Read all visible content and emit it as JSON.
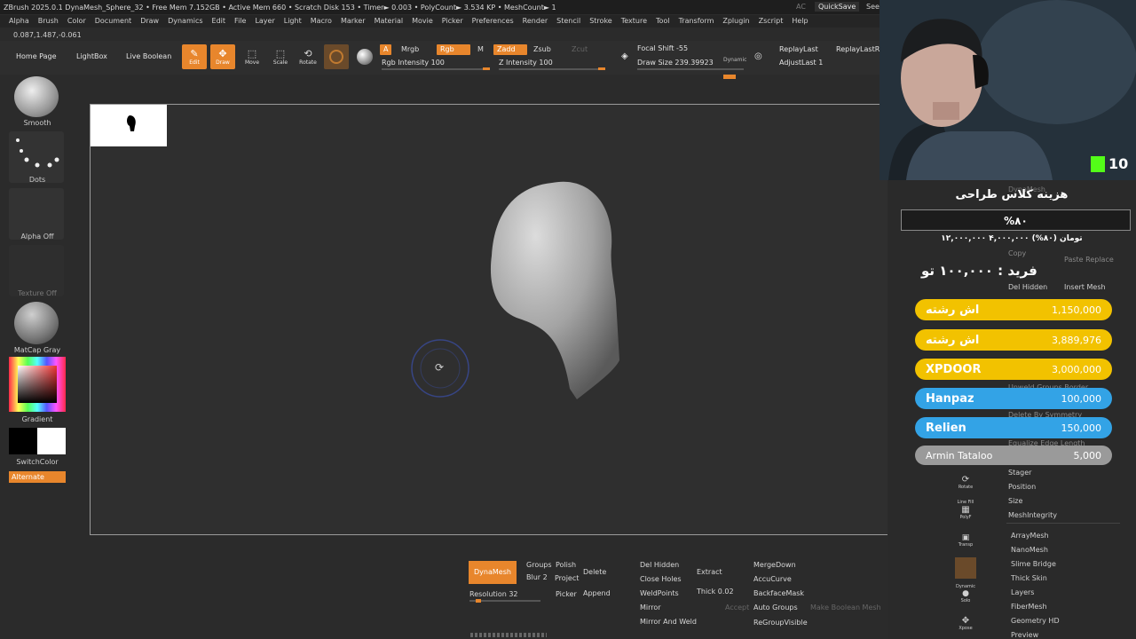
{
  "titlebar": {
    "title": "ZBrush 2025.0.1   DynaMesh_Sphere_32  • Free Mem 7.152GB • Active Mem 660 • Scratch Disk 153 • Timer► 0.003 • PolyCount► 3.534 KP • MeshCount► 1",
    "ac": "AC",
    "quicksave": "QuickSave",
    "see": "See"
  },
  "menu": [
    "Alpha",
    "Brush",
    "Color",
    "Document",
    "Draw",
    "Dynamics",
    "Edit",
    "File",
    "Layer",
    "Light",
    "Macro",
    "Marker",
    "Material",
    "Movie",
    "Picker",
    "Preferences",
    "Render",
    "Stencil",
    "Stroke",
    "Texture",
    "Tool",
    "Transform",
    "Zplugin",
    "Zscript",
    "Help"
  ],
  "coords": "0.087,1.487,-0.061",
  "toolbar": {
    "home": "Home Page",
    "lightbox": "LightBox",
    "live_boolean": "Live Boolean",
    "edit": "Edit",
    "draw": "Draw",
    "move": "Move",
    "scale": "Scale",
    "rotate": "Rotate",
    "a_label": "A",
    "mrgb": "Mrgb",
    "rgb": "Rgb",
    "m": "M",
    "zadd": "Zadd",
    "zsub": "Zsub",
    "zcut": "Zcut",
    "rgb_intensity": "Rgb Intensity 100",
    "z_intensity": "Z Intensity 100",
    "focal_shift": "Focal Shift -55",
    "draw_size": "Draw Size 239.39923",
    "dynamic": "Dynamic",
    "replay_last": "ReplayLast",
    "replay_last_rel": "ReplayLastRel",
    "adjust_last": "AdjustLast 1"
  },
  "left": {
    "smooth": "Smooth",
    "dots": "Dots",
    "alpha_off": "Alpha Off",
    "texture_off": "Texture Off",
    "matcap": "MatCap Gray",
    "gradient": "Gradient",
    "switch_color": "SwitchColor",
    "alternate": "Alternate"
  },
  "bottom": {
    "dynamesh": "DynaMesh",
    "groups": "Groups",
    "polish": "Polish",
    "blur": "Blur 2",
    "project": "Project",
    "delete": "Delete",
    "resolution": "Resolution 32",
    "picker": "Picker",
    "append": "Append",
    "del_hidden": "Del Hidden",
    "close_holes": "Close Holes",
    "weld_points": "WeldPoints",
    "mirror": "Mirror",
    "mirror_and_weld": "Mirror And Weld",
    "extract": "Extract",
    "thick": "Thick 0.02",
    "accept": "Accept",
    "merge_down": "MergeDown",
    "accu_curve": "AccuCurve",
    "backface_mask": "BackfaceMask",
    "auto_groups": "Auto Groups",
    "make_boolean_mesh": "Make Boolean Mesh",
    "regroup_visible": "ReGroupVisible"
  },
  "overlay": {
    "title": "هزینه کلاس طراحی",
    "percent": "%۸۰",
    "sub": "۱۲,۰۰۰,۰۰۰ ۴,۰۰۰,۰۰۰ تومان (۸۰%)",
    "price": "فرید : ۱۰۰,۰۰۰ تو",
    "kick_count": "10"
  },
  "donations": [
    {
      "name": "اش رشته",
      "amount": "1,150,000",
      "color": "#f2c200"
    },
    {
      "name": "اش رشته",
      "amount": "3,889,976",
      "color": "#f2c200"
    },
    {
      "name": "XPDOOR",
      "amount": "3,000,000",
      "color": "#f2c200"
    },
    {
      "name": "Hanpaz",
      "amount": "100,000",
      "color": "#33a3e6"
    },
    {
      "name": "Relien",
      "amount": "150,000",
      "color": "#33a3e6"
    },
    {
      "name": "Armin Tataloo",
      "amount": "5,000",
      "color": "#9a9a9a"
    }
  ],
  "right_menu": {
    "dyna_mesh_hint": "DynaMesh",
    "copy": "Copy",
    "paste_replace": "Paste Replace",
    "del_hidden": "Del Hidden",
    "insert_mesh": "Insert Mesh",
    "unweld_groups_border": "Unweld Groups Border",
    "delete_by_symmetry": "Delete By Symmetry",
    "equalize_edge_length": "Equalize Edge Length",
    "stager": "Stager",
    "position": "Position",
    "size": "Size",
    "mesh_integrity": "MeshIntegrity",
    "array_mesh": "ArrayMesh",
    "nano_mesh": "NanoMesh",
    "slime_bridge": "Slime Bridge",
    "thick_skin": "Thick Skin",
    "layers": "Layers",
    "fiber_mesh": "FiberMesh",
    "geometry_hd": "Geometry HD",
    "preview": "Preview",
    "rotate": "Rotate",
    "line_fill": "Line Fill",
    "polyf": "PolyF",
    "transp": "Transp",
    "solo": "Solo",
    "xpose": "Xpose",
    "dynamic": "Dynamic"
  }
}
